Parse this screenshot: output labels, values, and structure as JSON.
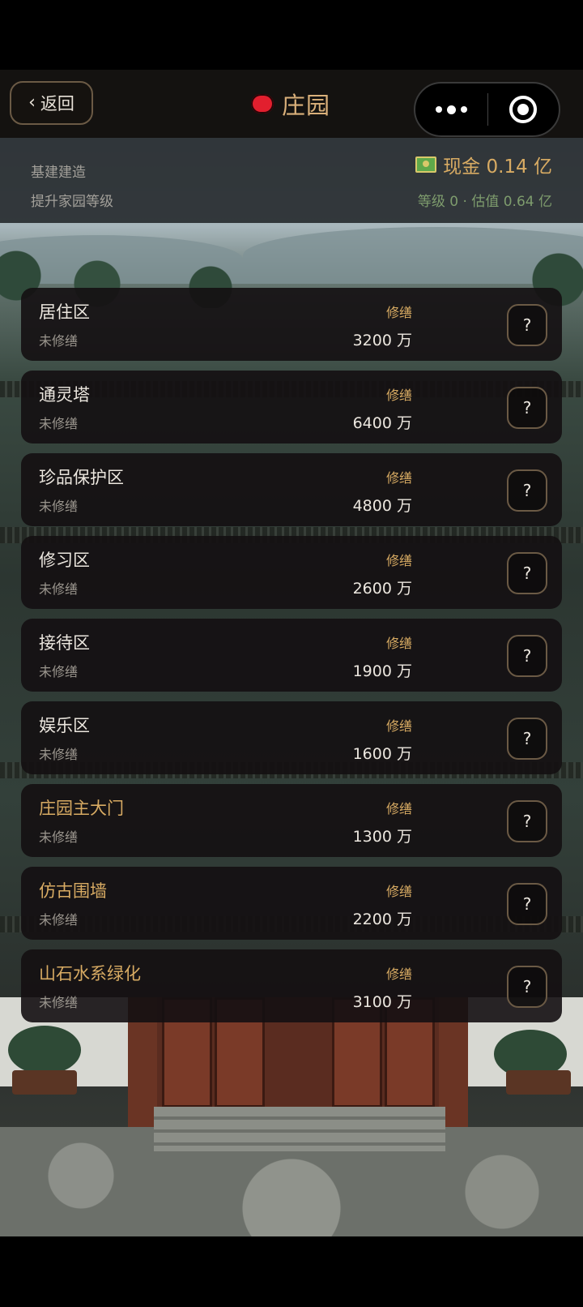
{
  "header": {
    "back_label": "返回",
    "title": "庄园",
    "title_dot_color": "#e21f2e",
    "capsule": {
      "more_icon": "more-dots-icon",
      "close_icon": "target-close-icon"
    }
  },
  "info": {
    "line1": "基建建造",
    "line2": "提升家园等级",
    "cash_text": "现金 0.14 亿",
    "level_text": "等级 0 · 估值 0.64 亿",
    "accent_color": "#d8ab63"
  },
  "buildings": [
    {
      "name": "居住区",
      "status": "未修缮",
      "action": "修缮",
      "cost": "3200 万",
      "help": "?",
      "name_color": "light"
    },
    {
      "name": "通灵塔",
      "status": "未修缮",
      "action": "修缮",
      "cost": "6400 万",
      "help": "?",
      "name_color": "light"
    },
    {
      "name": "珍品保护区",
      "status": "未修缮",
      "action": "修缮",
      "cost": "4800 万",
      "help": "?",
      "name_color": "light"
    },
    {
      "name": "修习区",
      "status": "未修缮",
      "action": "修缮",
      "cost": "2600 万",
      "help": "?",
      "name_color": "light"
    },
    {
      "name": "接待区",
      "status": "未修缮",
      "action": "修缮",
      "cost": "1900 万",
      "help": "?",
      "name_color": "light"
    },
    {
      "name": "娱乐区",
      "status": "未修缮",
      "action": "修缮",
      "cost": "1600 万",
      "help": "?",
      "name_color": "light"
    },
    {
      "name": "庄园主大门",
      "status": "未修缮",
      "action": "修缮",
      "cost": "1300 万",
      "help": "?",
      "name_color": "gold"
    },
    {
      "name": "仿古围墙",
      "status": "未修缮",
      "action": "修缮",
      "cost": "2200 万",
      "help": "?",
      "name_color": "gold"
    },
    {
      "name": "山石水系绿化",
      "status": "未修缮",
      "action": "修缮",
      "cost": "3100 万",
      "help": "?",
      "name_color": "gold"
    }
  ]
}
